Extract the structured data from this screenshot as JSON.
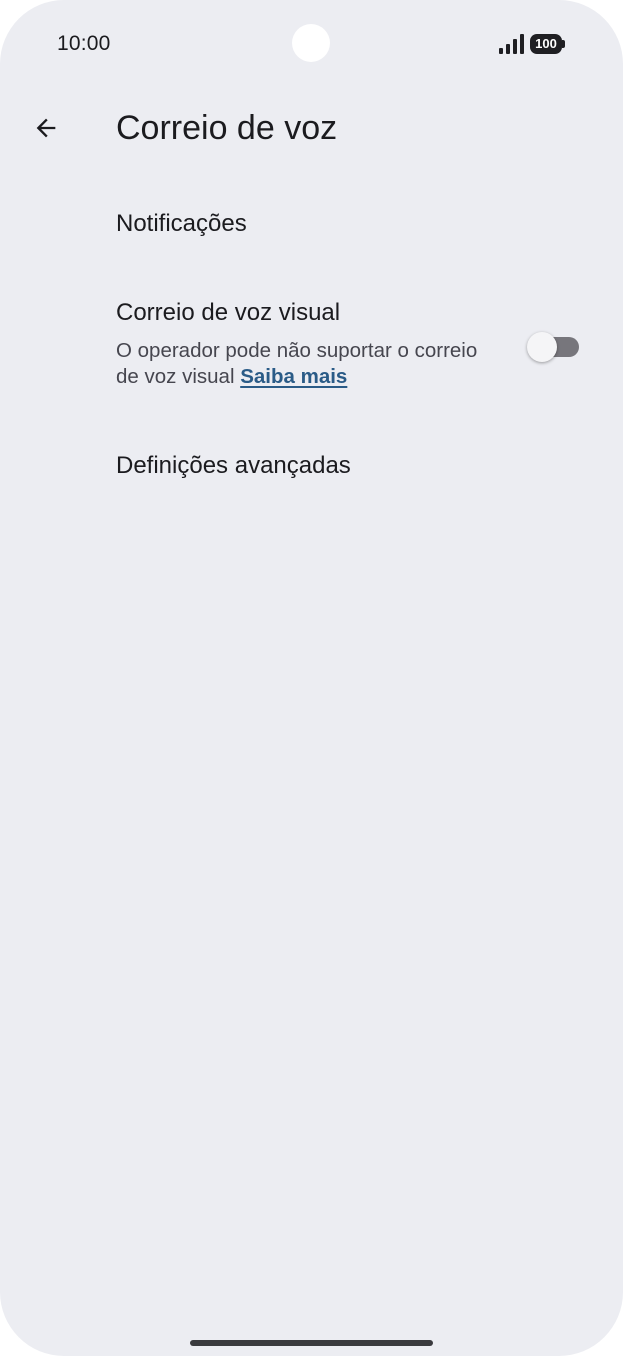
{
  "status_bar": {
    "time": "10:00",
    "battery": "100",
    "icons": [
      "camera-cutout",
      "signal-icon",
      "battery-icon"
    ]
  },
  "header": {
    "title": "Correio de voz",
    "back_icon": "arrow-left-icon"
  },
  "settings": {
    "notifications": {
      "title": "Notificações"
    },
    "visual_voicemail": {
      "title": "Correio de voz visual",
      "subtitle": "O operador pode não suportar o correio de voz visual",
      "link": "Saiba mais",
      "enabled": false
    },
    "advanced": {
      "title": "Definições avançadas"
    }
  },
  "colors": {
    "background": "#ECEDF2",
    "text_primary": "#1b1b1f",
    "text_secondary": "#46464f",
    "link": "#2a5b87",
    "switch_track_off": "#77767c"
  }
}
